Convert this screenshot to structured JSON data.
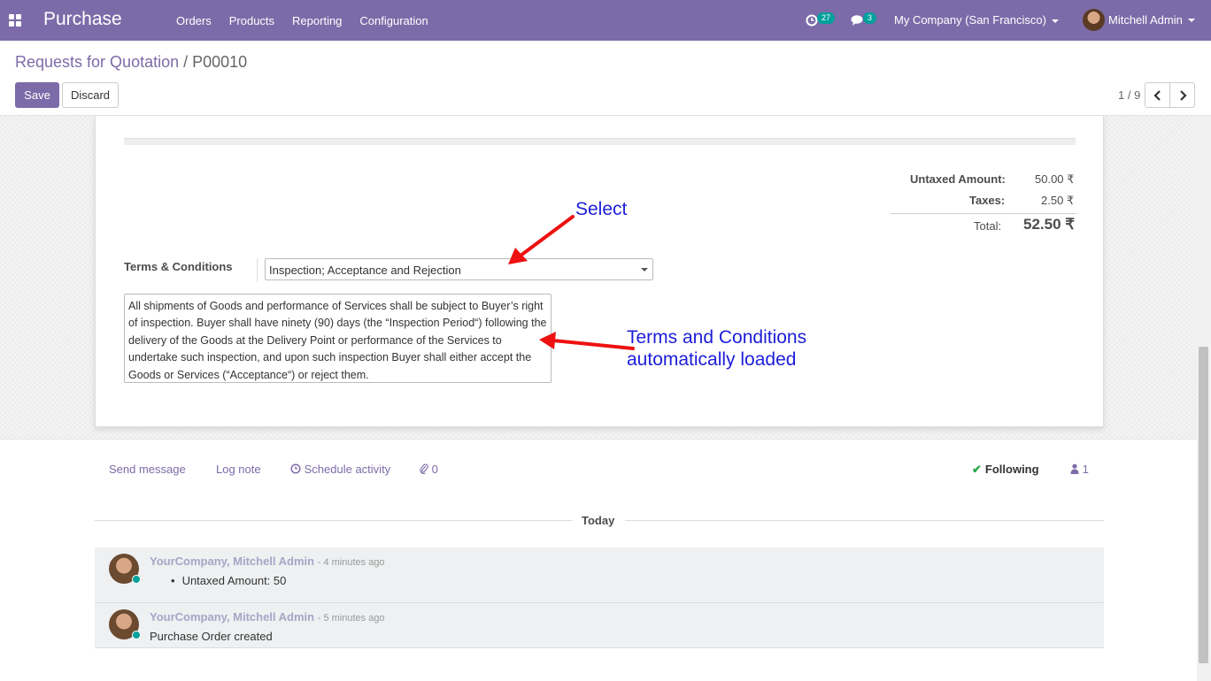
{
  "navbar": {
    "app_name": "Purchase",
    "menu": [
      "Orders",
      "Products",
      "Reporting",
      "Configuration"
    ],
    "activity_count": "27",
    "message_count": "3",
    "company": "My Company (San Francisco)",
    "user": "Mitchell Admin",
    "bg_color": "#7c6ba8"
  },
  "control_panel": {
    "breadcrumb_parent": "Requests for Quotation",
    "breadcrumb_sep": "/",
    "breadcrumb_current": "P00010",
    "save_label": "Save",
    "discard_label": "Discard",
    "pager": "1 / 9"
  },
  "totals": {
    "untaxed_label": "Untaxed Amount:",
    "untaxed_value": "50.00 ₹",
    "taxes_label": "Taxes:",
    "taxes_value": "2.50 ₹",
    "total_label": "Total:",
    "total_value": "52.50 ₹"
  },
  "terms": {
    "label": "Terms & Conditions",
    "selected": "Inspection; Acceptance and Rejection",
    "text": "All shipments of Goods and performance of Services shall be subject to Buyer’s right of inspection. Buyer shall have ninety (90) days (the “Inspection Period“) following the delivery of the Goods at the Delivery Point or performance of the Services to undertake such inspection, and upon such inspection Buyer shall either accept the Goods or Services (“Acceptance“) or reject them."
  },
  "annotations": {
    "select": "Select",
    "loaded_line1": "Terms and Conditions",
    "loaded_line2": "automatically loaded",
    "color": "#1d1dd8"
  },
  "chatter": {
    "send_message": "Send message",
    "log_note": "Log note",
    "schedule_activity": "Schedule activity",
    "attachments": "0",
    "following": "Following",
    "followers": "1",
    "today": "Today",
    "messages": [
      {
        "author": "YourCompany, Mitchell Admin",
        "time": "- 4 minutes ago",
        "body": "Untaxed Amount: 50"
      },
      {
        "author": "YourCompany, Mitchell Admin",
        "time": "- 5 minutes ago",
        "body": "Purchase Order created"
      }
    ]
  }
}
